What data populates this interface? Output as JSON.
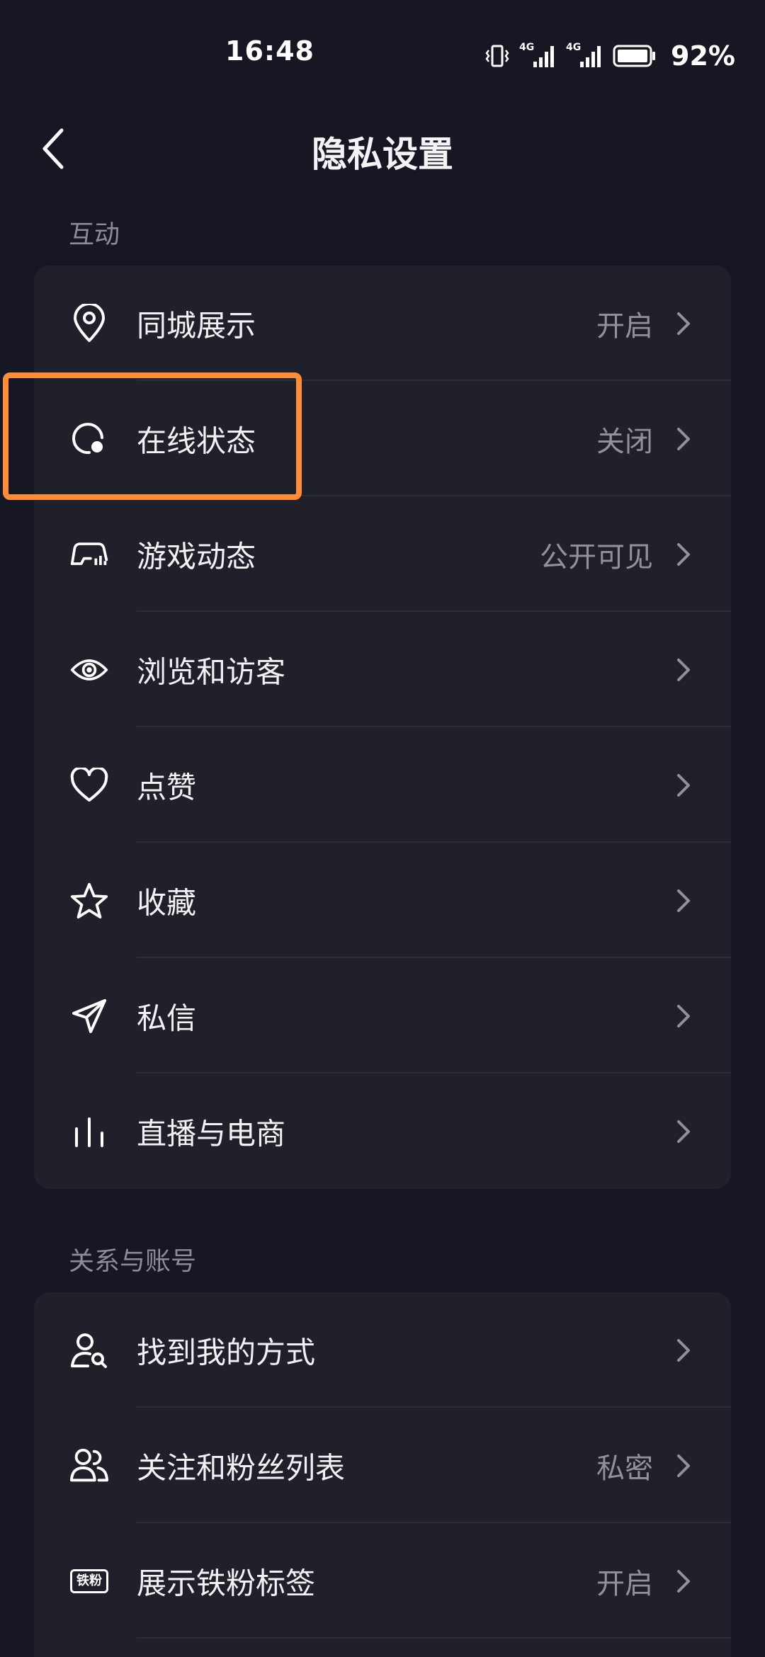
{
  "status_bar": {
    "time": "16:48",
    "battery": "92%",
    "network_1": "4G",
    "network_2": "4G"
  },
  "header": {
    "title": "隐私设置",
    "back_icon": "chevron-left-icon"
  },
  "sections": [
    {
      "title": "互动",
      "items": [
        {
          "label": "同城展示",
          "value": "开启",
          "icon": "location-pin-icon"
        },
        {
          "label": "在线状态",
          "value": "关闭",
          "icon": "online-status-icon"
        },
        {
          "label": "游戏动态",
          "value": "公开可见",
          "icon": "game-controller-icon"
        },
        {
          "label": "浏览和访客",
          "value": "",
          "icon": "eye-icon"
        },
        {
          "label": "点赞",
          "value": "",
          "icon": "heart-icon"
        },
        {
          "label": "收藏",
          "value": "",
          "icon": "star-icon"
        },
        {
          "label": "私信",
          "value": "",
          "icon": "send-icon"
        },
        {
          "label": "直播与电商",
          "value": "",
          "icon": "bars-icon"
        }
      ]
    },
    {
      "title": "关系与账号",
      "items": [
        {
          "label": "找到我的方式",
          "value": "",
          "icon": "user-search-icon"
        },
        {
          "label": "关注和粉丝列表",
          "value": "私密",
          "icon": "users-icon"
        },
        {
          "label": "展示铁粉标签",
          "value": "开启",
          "icon": "fan-badge-icon",
          "badge_text": "铁粉"
        }
      ]
    }
  ],
  "colors": {
    "background": "#161722",
    "card": "#1f2029",
    "highlight": "#ff8c38"
  }
}
